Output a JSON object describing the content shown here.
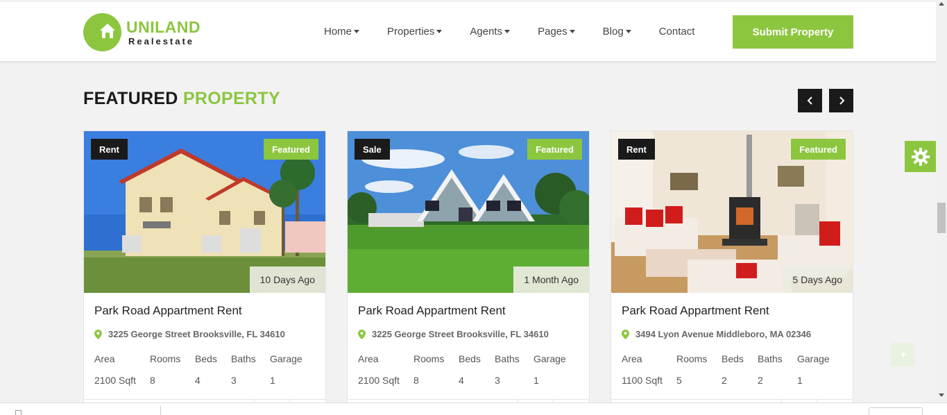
{
  "brand": {
    "name": "UNILAND",
    "tagline": "Realestate",
    "accent_color": "#8cc63f",
    "dark_color": "#1a1a1a"
  },
  "nav": {
    "items": [
      {
        "label": "Home",
        "has_dropdown": true
      },
      {
        "label": "Properties",
        "has_dropdown": true
      },
      {
        "label": "Agents",
        "has_dropdown": true
      },
      {
        "label": "Pages",
        "has_dropdown": true
      },
      {
        "label": "Blog",
        "has_dropdown": true
      },
      {
        "label": "Contact",
        "has_dropdown": false
      }
    ],
    "submit_label": "Submit Property"
  },
  "section": {
    "title_dark": "FEATURED",
    "title_green": "PROPERTY",
    "prev_icon": "chevron-left-icon",
    "next_icon": "chevron-right-icon"
  },
  "spec_labels": [
    "Area",
    "Rooms",
    "Beds",
    "Baths",
    "Garage"
  ],
  "cards": [
    {
      "type": "Rent",
      "featured": "Featured",
      "date": "10 Days Ago",
      "title": "Park Road Appartment Rent",
      "address": "3225 George Street Brooksville, FL 34610",
      "area": "2100 Sqft",
      "rooms": "8",
      "beds": "4",
      "baths": "3",
      "garage": "1"
    },
    {
      "type": "Sale",
      "featured": "Featured",
      "date": "1 Month Ago",
      "title": "Park Road Appartment Rent",
      "address": "3225 George Street Brooksville, FL 34610",
      "area": "2100 Sqft",
      "rooms": "8",
      "beds": "4",
      "baths": "3",
      "garage": "1"
    },
    {
      "type": "Rent",
      "featured": "Featured",
      "date": "5 Days Ago",
      "title": "Park Road Appartment Rent",
      "address": "3494 Lyon Avenue Middleboro, MA 02346",
      "area": "1100 Sqft",
      "rooms": "5",
      "beds": "2",
      "baths": "2",
      "garage": "1"
    }
  ],
  "widgets": {
    "settings_icon": "gear-icon",
    "back_to_top_icon": "arrow-up-icon"
  }
}
